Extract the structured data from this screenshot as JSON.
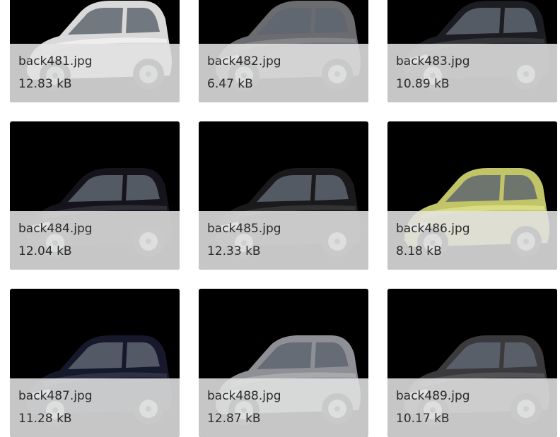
{
  "gallery": {
    "items": [
      {
        "name": "back481.jpg",
        "size": "12.83 kB",
        "car_color": "#d9d9d9"
      },
      {
        "name": "back482.jpg",
        "size": "6.47 kB",
        "car_color": "#6a6c70"
      },
      {
        "name": "back483.jpg",
        "size": "10.89 kB",
        "car_color": "#1c1d22"
      },
      {
        "name": "back484.jpg",
        "size": "12.04 kB",
        "car_color": "#15141c"
      },
      {
        "name": "back485.jpg",
        "size": "12.33 kB",
        "car_color": "#1a1a1c"
      },
      {
        "name": "back486.jpg",
        "size": "8.18 kB",
        "car_color": "#c2c468"
      },
      {
        "name": "back487.jpg",
        "size": "11.28 kB",
        "car_color": "#16182c"
      },
      {
        "name": "back488.jpg",
        "size": "12.87 kB",
        "car_color": "#8e9096"
      },
      {
        "name": "back489.jpg",
        "size": "10.17 kB",
        "car_color": "#3a3a3c"
      }
    ]
  }
}
